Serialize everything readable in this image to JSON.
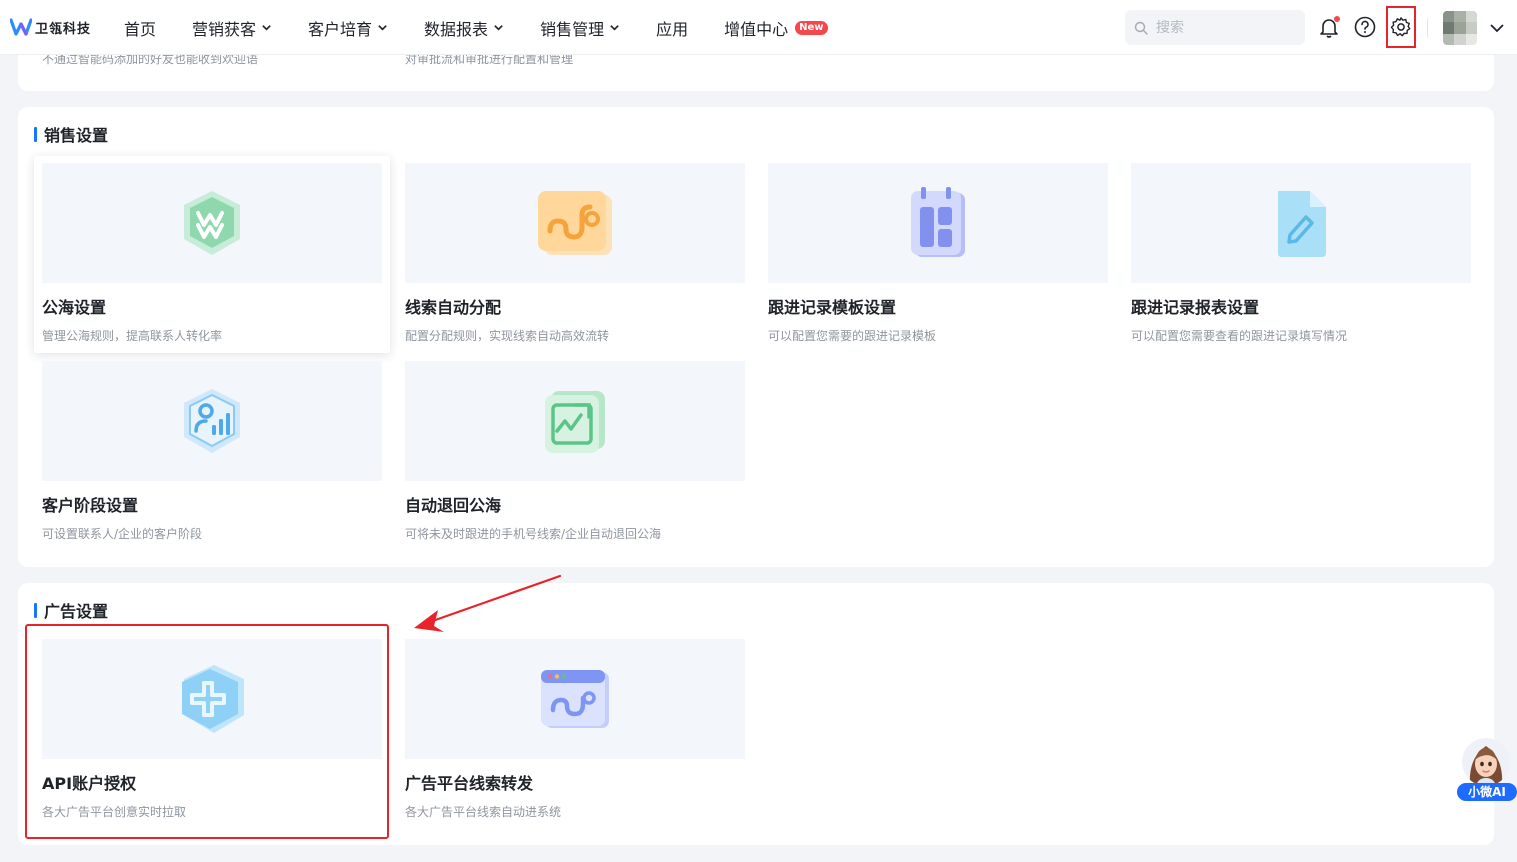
{
  "app": {
    "logo_text": "卫瓴科技",
    "accent_color": "#1677ff",
    "highlight_color": "#e8242a"
  },
  "nav": {
    "items": [
      {
        "label": "首页",
        "has_dropdown": false
      },
      {
        "label": "营销获客",
        "has_dropdown": true
      },
      {
        "label": "客户培育",
        "has_dropdown": true
      },
      {
        "label": "数据报表",
        "has_dropdown": true
      },
      {
        "label": "销售管理",
        "has_dropdown": true
      },
      {
        "label": "应用",
        "has_dropdown": false
      },
      {
        "label": "增值中心",
        "has_dropdown": false,
        "badge": "New"
      }
    ]
  },
  "header": {
    "search_placeholder": "搜索",
    "icons": [
      "bell-icon",
      "help-icon",
      "settings-gear-icon",
      "user-avatar",
      "chevron-down-icon"
    ]
  },
  "previous_section": {
    "desc_1": "不通过智能码添加的好友也能收到欢迎语",
    "desc_2": "对审批流和审批进行配置和管理"
  },
  "sales_settings": {
    "title": "销售设置",
    "items": [
      {
        "name": "公海设置",
        "desc": "管理公海规则，提高联系人转化率",
        "icon": "public-sea-icon"
      },
      {
        "name": "线索自动分配",
        "desc": "配置分配规则，实现线索自动高效流转",
        "icon": "lead-flow-icon"
      },
      {
        "name": "跟进记录模板设置",
        "desc": "可以配置您需要的跟进记录模板",
        "icon": "calendar-template-icon"
      },
      {
        "name": "跟进记录报表设置",
        "desc": "可以配置您需要查看的跟进记录填写情况",
        "icon": "document-edit-icon"
      },
      {
        "name": "客户阶段设置",
        "desc": "可设置联系人/企业的客户阶段",
        "icon": "customer-stage-icon"
      },
      {
        "name": "自动退回公海",
        "desc": "可将未及时跟进的手机号线索/企业自动退回公海",
        "icon": "auto-return-icon"
      }
    ]
  },
  "ad_settings": {
    "title": "广告设置",
    "items": [
      {
        "name": "API账户授权",
        "desc": "各大广告平台创意实时拉取",
        "icon": "api-auth-icon"
      },
      {
        "name": "广告平台线索转发",
        "desc": "各大广告平台线索自动进系统",
        "icon": "ad-lead-forward-icon"
      }
    ]
  },
  "ai_assistant": {
    "label": "小微AI"
  }
}
